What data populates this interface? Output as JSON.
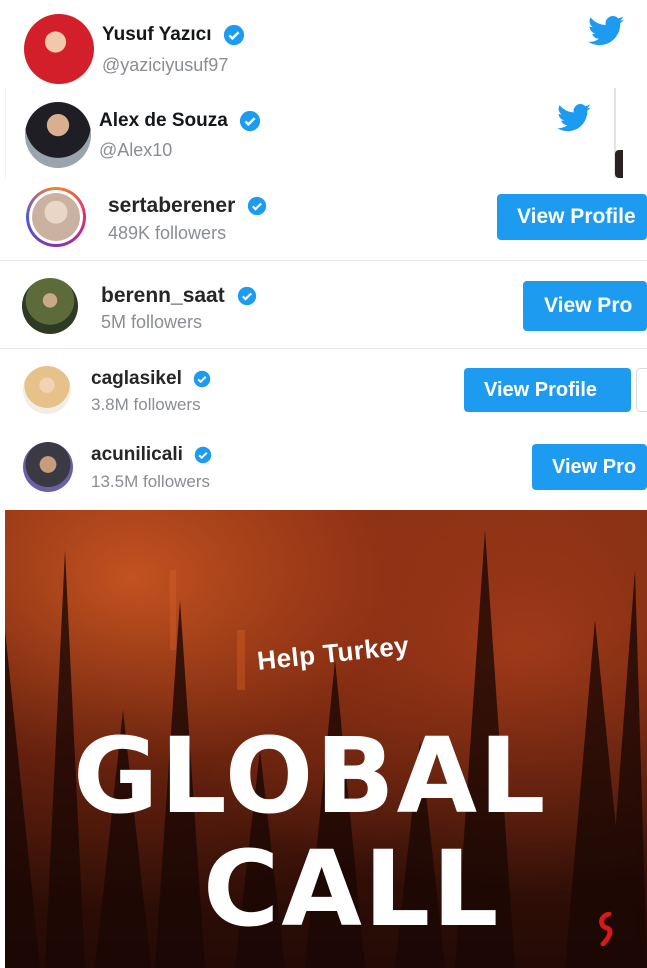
{
  "twitter_cards": [
    {
      "name": "Yusuf Yazıcı",
      "handle": "@yaziciyusuf97",
      "verified": true,
      "icon": "twitter-bird-icon"
    },
    {
      "name": "Alex de Souza",
      "handle": "@Alex10",
      "verified": true,
      "icon": "twitter-bird-icon"
    }
  ],
  "instagram_profiles": [
    {
      "username": "sertaberener",
      "followers": "489K followers",
      "button": "View Profile"
    },
    {
      "username": "berenn_saat",
      "followers": "5M followers",
      "button": "View Pro"
    },
    {
      "username": "caglasikel",
      "followers": "3.8M followers",
      "button": "View Profile"
    },
    {
      "username": "acunilicali",
      "followers": "13.5M followers",
      "button": "View Pro"
    }
  ],
  "poster": {
    "kicker": "Help Turkey",
    "headline_1": "GLOBAL",
    "headline_2": "CALL"
  },
  "colors": {
    "verified_blue": "#1d9bf0",
    "button_blue": "#1d9bf0",
    "poster_dark": "#2a0d06",
    "poster_glow": "#b8431a"
  }
}
